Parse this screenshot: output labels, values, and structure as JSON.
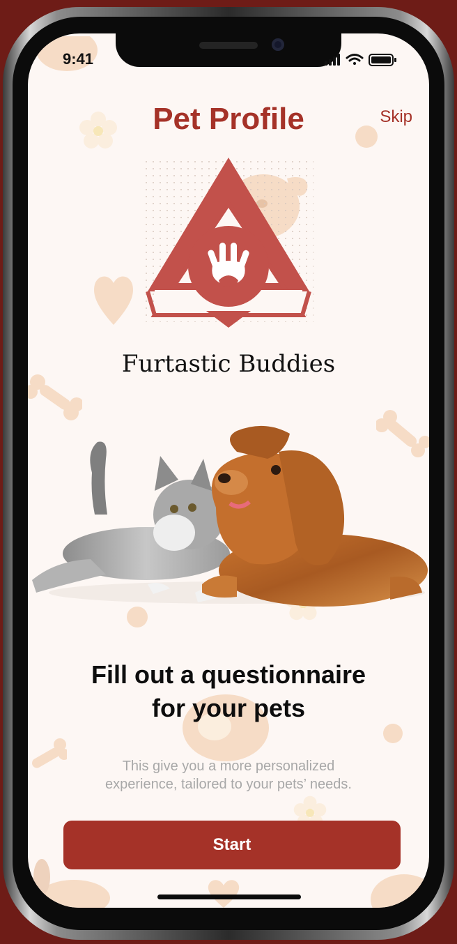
{
  "status_bar": {
    "time": "9:41",
    "icons": [
      "signal-icon",
      "wifi-icon",
      "battery-icon"
    ]
  },
  "header": {
    "title": "Pet Profile",
    "skip_label": "Skip"
  },
  "logo": {
    "icon": "paw-print-icon",
    "brand_name": "Furtastic Buddies"
  },
  "illustration": {
    "subject": "pets-illustration"
  },
  "content": {
    "headline_line1": "Fill out a questionnaire",
    "headline_line2": "for your pets",
    "subtext_line1": "This give you a more personalized",
    "subtext_line2": "experience, tailored to your pets’ needs."
  },
  "actions": {
    "start_label": "Start"
  },
  "colors": {
    "accent": "#a53228",
    "background": "#fdf7f4",
    "frame": "#6e1c17",
    "decor": "#f6dcc6"
  }
}
